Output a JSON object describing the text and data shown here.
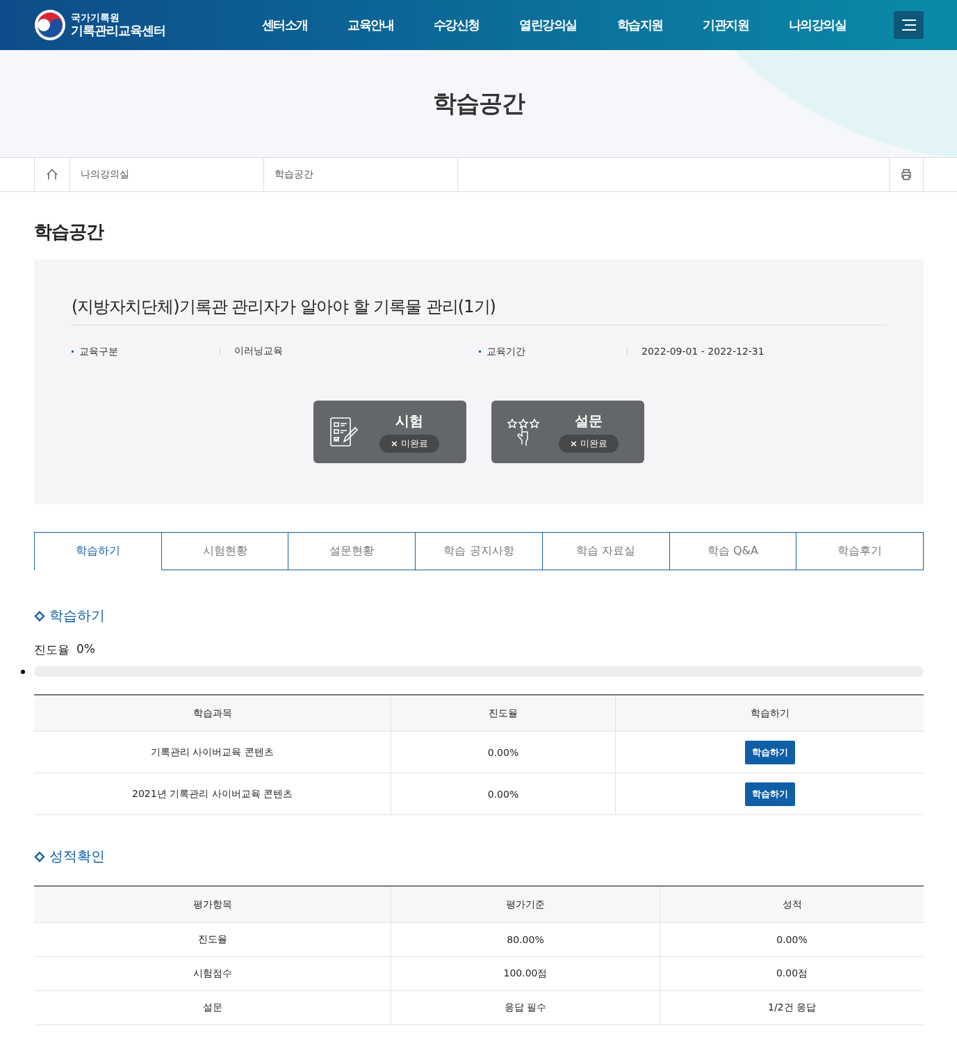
{
  "header": {
    "logo_top": "국가기록원",
    "logo_bottom": "기록관리교육센터",
    "nav": [
      "센터소개",
      "교육안내",
      "수강신청",
      "열린강의실",
      "학습지원",
      "기관지원",
      "나의강의실"
    ]
  },
  "hero": {
    "title": "학습공간"
  },
  "breadcrumb": [
    "나의강의실",
    "학습공간"
  ],
  "page_title": "학습공간",
  "course": {
    "title": "(지방자치단체)기록관 관리자가 알아야 할 기록물 관리(1기)",
    "info": [
      {
        "label": "교육구분",
        "value": "이러닝교육"
      },
      {
        "label": "교육기간",
        "value": "2022-09-01 - 2022-12-31"
      }
    ],
    "tasks": [
      {
        "kind": "exam",
        "title": "시험",
        "status_mark": "×",
        "status": "미완료",
        "done": false
      },
      {
        "kind": "survey",
        "title": "설문",
        "status_mark": "×",
        "status": "미완료",
        "done": false
      }
    ]
  },
  "tabs": [
    {
      "label": "학습하기",
      "selected": true
    },
    {
      "label": "시험현황",
      "selected": false
    },
    {
      "label": "설문현황",
      "selected": false
    },
    {
      "label": "학습 공지사항",
      "selected": false
    },
    {
      "label": "학습 자료실",
      "selected": false
    },
    {
      "label": "학습 Q&A",
      "selected": false
    },
    {
      "label": "학습후기",
      "selected": false
    }
  ],
  "study": {
    "heading": "학습하기",
    "progress_label": "진도율",
    "progress_value": "0%",
    "level": 0,
    "columns": [
      "학습과목",
      "진도율",
      "학습하기"
    ],
    "rows": [
      {
        "subject": "기록관리 사이버교육 콘텐츠",
        "progress": "0.00%",
        "button": "학습하기"
      },
      {
        "subject": "2021년 기록관리 사이버교육 콘텐츠",
        "progress": "0.00%",
        "button": "학습하기"
      }
    ]
  },
  "grades": {
    "heading": "성적확인",
    "columns": [
      "평가항목",
      "평가기준",
      "성적"
    ],
    "rows": [
      [
        "진도율",
        "80.00%",
        "0.00%"
      ],
      [
        "시험점수",
        "100.00점",
        "0.00점"
      ],
      [
        "설문",
        "응답 필수",
        "1/2건 응답"
      ]
    ]
  }
}
